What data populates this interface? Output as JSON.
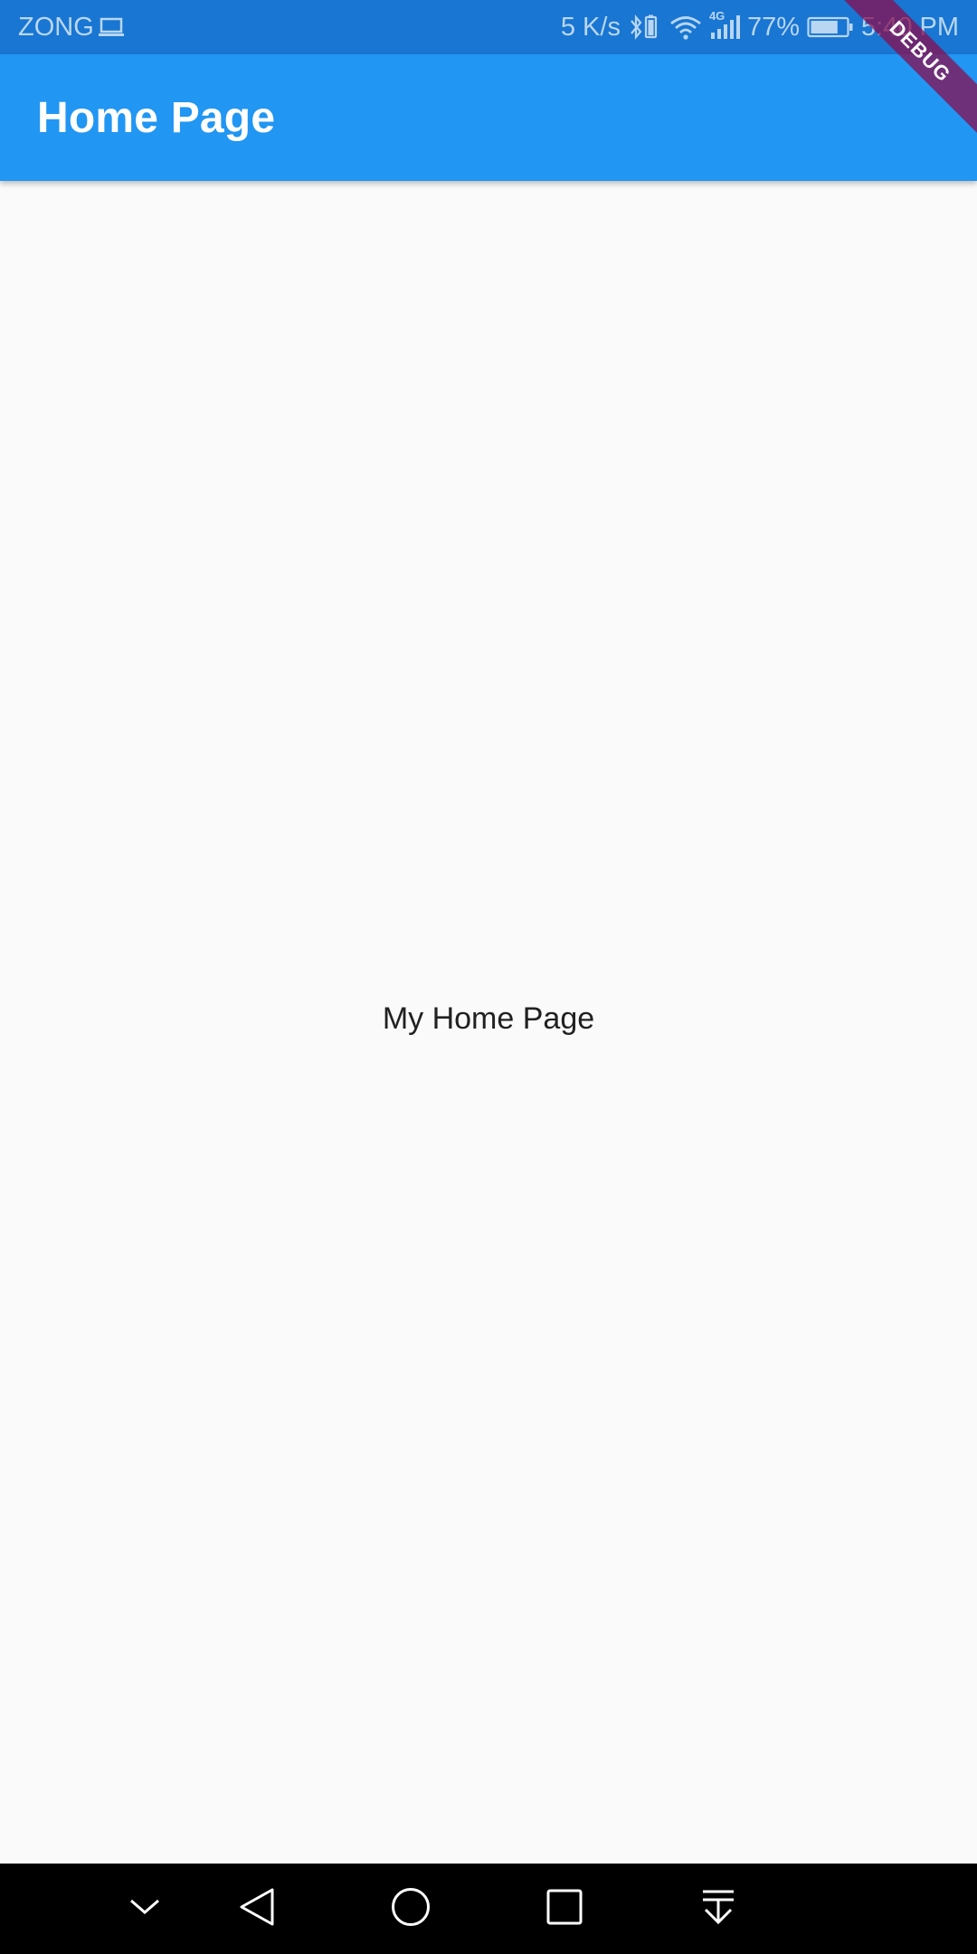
{
  "status_bar": {
    "carrier": "ZONG",
    "network_speed": "5 K/s",
    "network_type": "4G",
    "battery_percent": "77%",
    "battery_level": 0.77,
    "time": "5:40 PM",
    "icons": [
      "laptop-icon",
      "bluetooth-icon",
      "wifi-icon",
      "signal-icon",
      "battery-icon"
    ]
  },
  "app_bar": {
    "title": "Home Page",
    "color": "#2196f3"
  },
  "body": {
    "text": "My Home Page"
  },
  "debug_banner": {
    "label": "DEBUG"
  },
  "nav_bar": {
    "buttons": [
      "chevron-down-icon",
      "back-icon",
      "home-icon",
      "recents-icon",
      "notification-pull-icon"
    ]
  }
}
